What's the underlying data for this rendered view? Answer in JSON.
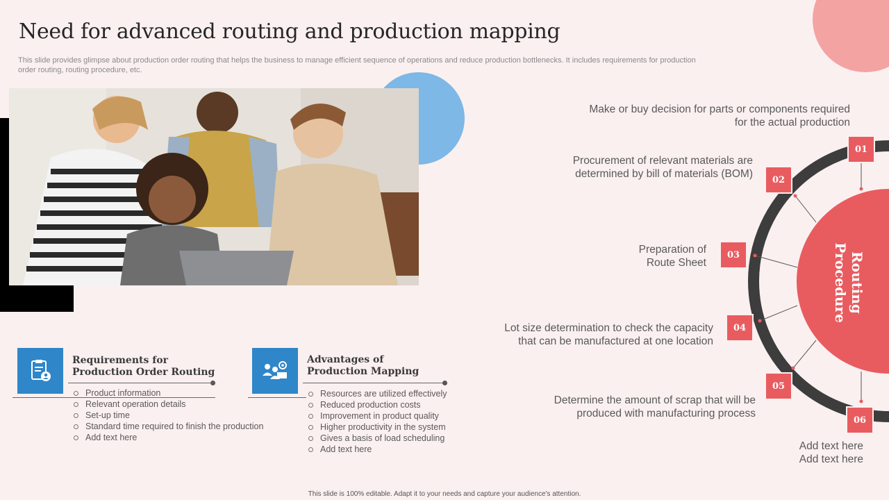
{
  "title": "Need for advanced routing and production mapping",
  "subtitle": "This slide provides glimpse about production order routing that helps the business to manage efficient sequence of operations and reduce production bottlenecks. It includes requirements for production order routing, routing procedure, etc.",
  "colors": {
    "accent_red": "#e85c60",
    "ring_dark": "#3d3d3d",
    "icon_blue": "#2f86c9",
    "deco_blue": "#7db8e6",
    "deco_pink": "#f4a3a3"
  },
  "cards": [
    {
      "icon": "clipboard-user-icon",
      "title_line1": "Requirements for",
      "title_line2": "Production Order Routing",
      "bullets": [
        "Product information",
        "Relevant  operation details",
        "Set-up time",
        "Standard time required to finish the production",
        "Add text here"
      ]
    },
    {
      "icon": "team-settings-icon",
      "title_line1": "Advantages of",
      "title_line2": "Production Mapping",
      "bullets": [
        "Resources are utilized effectively",
        "Reduced production costs",
        "Improvement  in product quality",
        "Higher productivity in the system",
        "Gives  a basis of load scheduling",
        "Add text here"
      ]
    }
  ],
  "routing": {
    "center_label_line1": "Routing",
    "center_label_line2": "Procedure",
    "steps": [
      {
        "number": "01",
        "line1": "Make or buy decision for parts or components required",
        "line2": "for the actual production"
      },
      {
        "number": "02",
        "line1": "Procurement  of relevant materials are",
        "line2": "determined by bill of materials (BOM)"
      },
      {
        "number": "03",
        "line1": "Preparation of",
        "line2": "Route Sheet"
      },
      {
        "number": "04",
        "line1": "Lot size determination to check the capacity",
        "line2": "that can be manufactured  at one location"
      },
      {
        "number": "05",
        "line1": "Determine the amount of scrap that will be",
        "line2": "produced with manufacturing process"
      },
      {
        "number": "06",
        "line1": "Add text here",
        "line2": "Add text here"
      }
    ]
  },
  "footer": "This slide is 100% editable.  Adapt it to your needs and capture your audience's attention."
}
